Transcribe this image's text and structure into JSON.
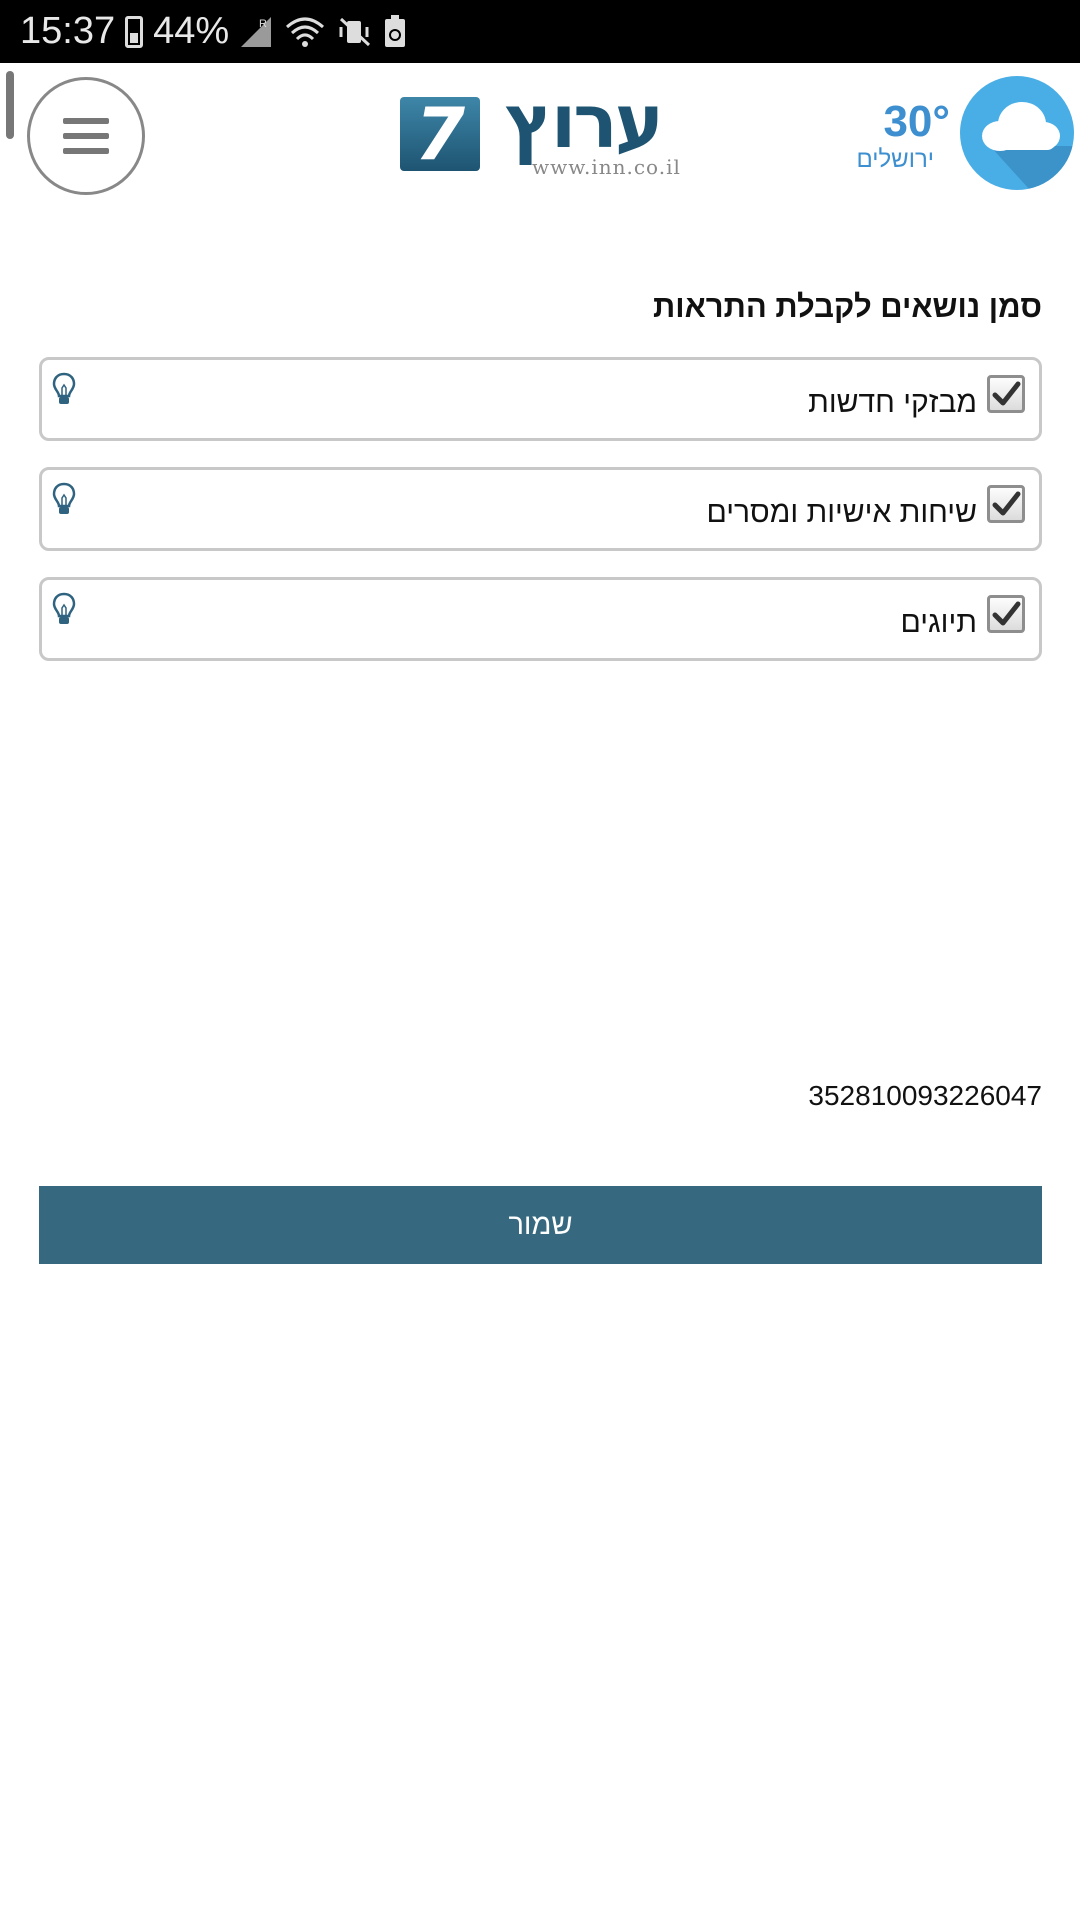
{
  "status_bar": {
    "time": "15:37",
    "battery_percent": "44%",
    "icons": [
      "battery-icon",
      "signal-roaming-icon",
      "wifi-icon",
      "vibrate-mute-icon",
      "battery-saver-icon"
    ]
  },
  "header": {
    "logo": {
      "number": "7",
      "hebrew": "ערוץ",
      "url": "www.inn.co.il"
    },
    "weather": {
      "temperature": "30°",
      "city": "ירושלים",
      "icon": "cloud-icon"
    },
    "menu_icon": "hamburger-menu-icon"
  },
  "main": {
    "title": "סמן נושאים לקבלת התראות",
    "topics": [
      {
        "label": "מבזקי חדשות",
        "checked": true
      },
      {
        "label": "שיחות אישיות ומסרים",
        "checked": true
      },
      {
        "label": "תיוגים",
        "checked": true
      }
    ],
    "device_id": "352810093226047",
    "save_label": "שמור"
  },
  "colors": {
    "primary_button": "#36697f",
    "weather_blue": "#3d8fd0",
    "logo_blue": "#1e5472",
    "border_gray": "#c8c8c8"
  }
}
